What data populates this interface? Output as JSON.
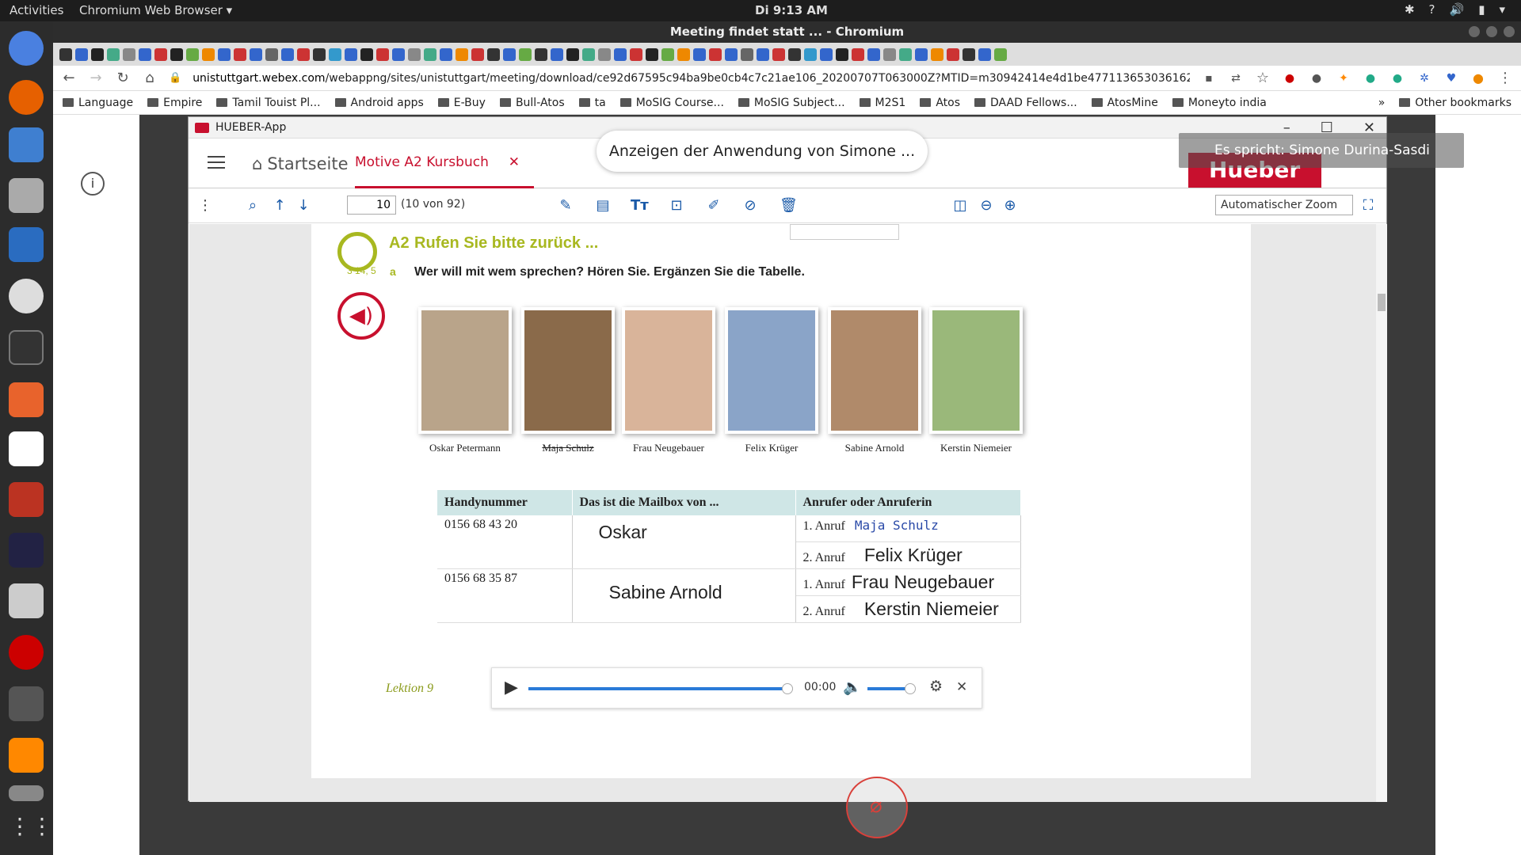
{
  "system": {
    "activities": "Activities",
    "app_menu": "Chromium Web Browser ▾",
    "clock": "Di  9:13 AM"
  },
  "browser": {
    "window_title": "Meeting findet statt ... - Chromium",
    "url_host": "unistuttgart.webex.com",
    "url_path": "/webappng/sites/unistuttgart/meeting/download/ce92d67595c94ba9be0cb4c7c21ae106_20200707T063000Z?MTID=m30942414e4d1be47711365303616​2165&launchApp...",
    "bookmarks": [
      "Language",
      "Empire",
      "Tamil Touist Pl...",
      "Android apps",
      "E-Buy",
      "Bull-Atos",
      "ta",
      "MoSIG Course...",
      "MoSIG Subject...",
      "M2S1",
      "Atos",
      "DAAD Fellows...",
      "AtosMine",
      "Moneyto india"
    ],
    "other_bookmarks": "Other bookmarks",
    "more": "»"
  },
  "webex": {
    "banner": "Anzeigen der Anwendung von Simone ...",
    "speaker": "Es spricht: Simone Durina-Sasdi"
  },
  "hueber": {
    "window_title": "HUEBER-App",
    "home": "Startseite",
    "tab": "Motive A2 Kursbuch",
    "logo": "Hueber",
    "page_number": "10",
    "page_of": "(10 von 92)",
    "zoom": "Automatischer Zoom"
  },
  "exercise": {
    "number": "A2",
    "title": "Rufen Sie bitte zurück ...",
    "track": "3 14, 5",
    "sub_letter": "a",
    "instruction": "Wer will mit wem sprechen? Hören Sie. Ergänzen Sie die Tabelle.",
    "people": [
      "Oskar Petermann",
      "Maja Schulz",
      "Frau Neugebauer",
      "Felix Krüger",
      "Sabine Arnold",
      "Kerstin Niemeier"
    ],
    "table": {
      "headers": [
        "Handynummer",
        "Das ist die Mailbox von ...",
        "Anrufer oder Anruferin"
      ],
      "rows": [
        {
          "phone": "0156 68 43 20",
          "mailbox": "Oskar",
          "call1_label": "1. Anruf",
          "call1": "Maja Schulz",
          "call2_label": "2. Anruf",
          "call2": "Felix Krüger"
        },
        {
          "phone": "0156 68 35 87",
          "mailbox": "Sabine Arnold",
          "call1_label": "1. Anruf",
          "call1": "Frau Neugebauer",
          "call2_label": "2. Anruf",
          "call2": "Kerstin Niemeier"
        }
      ]
    },
    "lesson": "Lektion 9"
  },
  "player": {
    "time": "00:00",
    "progress": 0.98,
    "volume": 0.9
  }
}
